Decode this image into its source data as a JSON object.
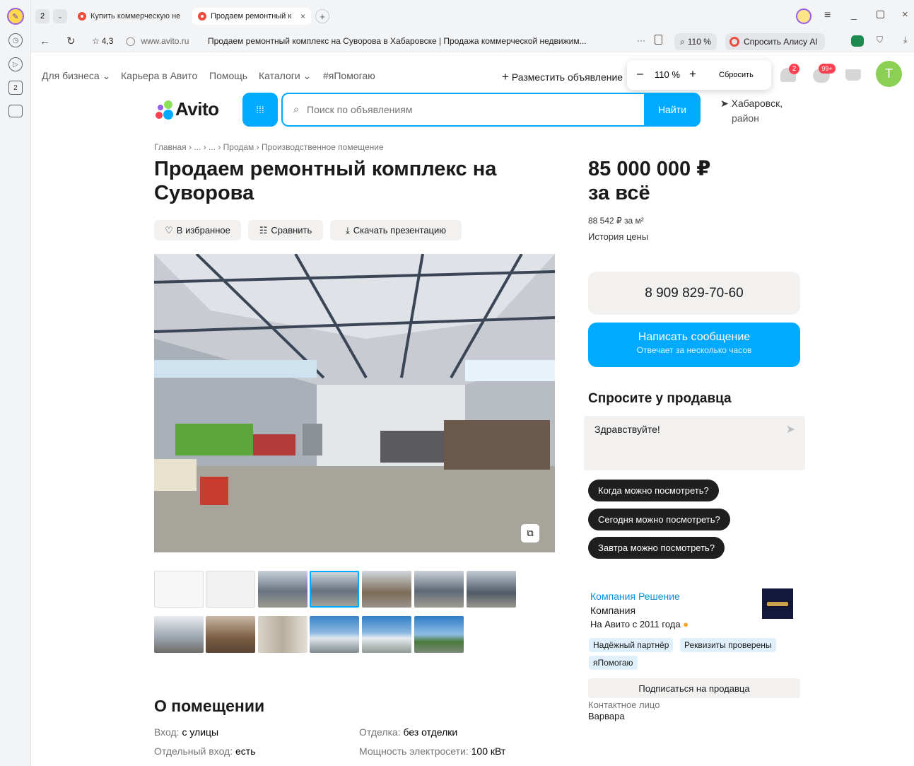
{
  "browser": {
    "tab_count": "2",
    "tabs": [
      {
        "title": "Купить коммерческую не"
      },
      {
        "title": "Продаем ремонтный к"
      }
    ],
    "rating": "4,3",
    "domain": "www.avito.ru",
    "page_title": "Продаем ремонтный комплекс на Суворова в Хабаровске | Продажа коммерческой недвижим...",
    "zoom": "110 %",
    "alice_label": "Спросить Алису AI",
    "leftbar_badge": "2"
  },
  "site_nav": {
    "items": [
      "Для бизнеса",
      "Карьера в Авито",
      "Помощь",
      "Каталоги",
      "#яПомогаю"
    ],
    "post_ad": "Разместить объявление",
    "notif_badge": "2",
    "msg_badge": "99+",
    "avatar_letter": "T"
  },
  "zoom_popup": {
    "minus": "–",
    "value": "110 %",
    "plus": "+",
    "reset": "Сбросить"
  },
  "search": {
    "logo": "Avito",
    "placeholder": "Поиск по объявлениям",
    "button": "Найти",
    "location_city": "Хабаровск,",
    "location_region": "район"
  },
  "breadcrumb": "Главная › ... › ... › Продам › Производственное помещение",
  "title_line1": "Продаем ремонтный комплекс на",
  "title_line2": "Суворова",
  "actions": {
    "favorite": "В избранное",
    "compare": "Сравнить",
    "download": "Скачать презентацию"
  },
  "price": {
    "line1": "85 000 000 ₽",
    "line2": "за всё",
    "per_m2": "88 542 ₽ за м²",
    "history": "История цены"
  },
  "contact": {
    "phone": "8 909 829-70-60",
    "message_title": "Написать сообщение",
    "message_sub": "Отвечает за несколько часов"
  },
  "ask": {
    "heading": "Спросите у продавца",
    "input_value": "Здравствуйте!",
    "quick": [
      "Когда можно посмотреть?",
      "Сегодня можно посмотреть?",
      "Завтра можно посмотреть?"
    ]
  },
  "seller": {
    "name": "Компания Решение",
    "type": "Компания",
    "since": "На Авито с 2011 года",
    "badges": [
      "Надёжный партнёр",
      "Реквизиты проверены",
      "яПомогаю"
    ],
    "subscribe": "Подписаться на продавца",
    "contact_label": "Контактное лицо",
    "contact_name": "Варвара"
  },
  "about": {
    "heading": "О помещении",
    "left": [
      {
        "k": "Вход: ",
        "v": "с улицы"
      },
      {
        "k": "Отдельный вход: ",
        "v": "есть"
      }
    ],
    "right": [
      {
        "k": "Отделка: ",
        "v": "без отделки"
      },
      {
        "k": "Мощность электросети: ",
        "v": "100 кВт"
      }
    ]
  },
  "colors": {
    "accent": "#00aaff",
    "brand_green": "#8ee05a",
    "brand_red": "#ff4053",
    "brand_purple": "#965eeb"
  }
}
